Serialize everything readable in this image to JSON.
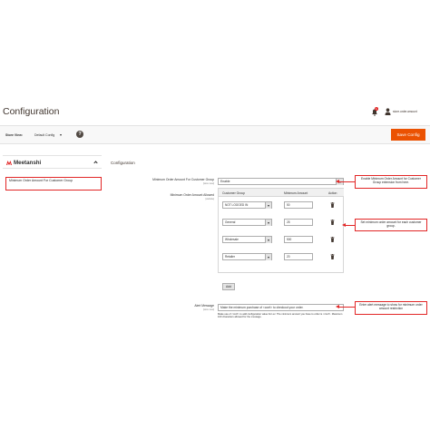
{
  "header": {
    "title": "Configuration",
    "notifications_count": "1",
    "user_name": "store.order.amount"
  },
  "scope": {
    "label": "Store View:",
    "value": "Default Config",
    "help": "?"
  },
  "actions": {
    "save_label": "Save Config"
  },
  "sidebar": {
    "brand": "Meetanshi",
    "item_label": "Minimum Order Amount For Customer Group"
  },
  "section": {
    "title": "Configuration"
  },
  "fields": {
    "enable": {
      "label": "Minimum Order Amount For Customer Group",
      "scope": "[store view]",
      "value": "Enable"
    },
    "allowed": {
      "label": "Minimum Order Amount Allowed",
      "scope": "[website]",
      "columns": [
        "Customer Group",
        "Minimum Amount",
        "Action"
      ],
      "rows": [
        {
          "group": "NOT LOGGED IN",
          "amount": "50"
        },
        {
          "group": "General",
          "amount": "25"
        },
        {
          "group": "Wholesale",
          "amount": "500"
        },
        {
          "group": "Retailer",
          "amount": "20"
        }
      ],
      "add_label": "Add"
    },
    "alert": {
      "label": "Alert Message",
      "scope": "[store view]",
      "value": "Make the minimum purchase of <conf> to checkout your order.",
      "note": "Make use of <conf> to add configuration value For ex: The minimum amount you have to order is <conf>. Maximum 100 characters allowed for the message."
    }
  },
  "callouts": {
    "enable": "Enable Minimum Order Amount for Customer Group extension from here.",
    "allowed": "Set minimum order amount for each customer group.",
    "alert": "Enter alert message to show for minimum order amount restriction"
  },
  "colors": {
    "accent": "#eb5202",
    "callout_border": "#e22626"
  }
}
